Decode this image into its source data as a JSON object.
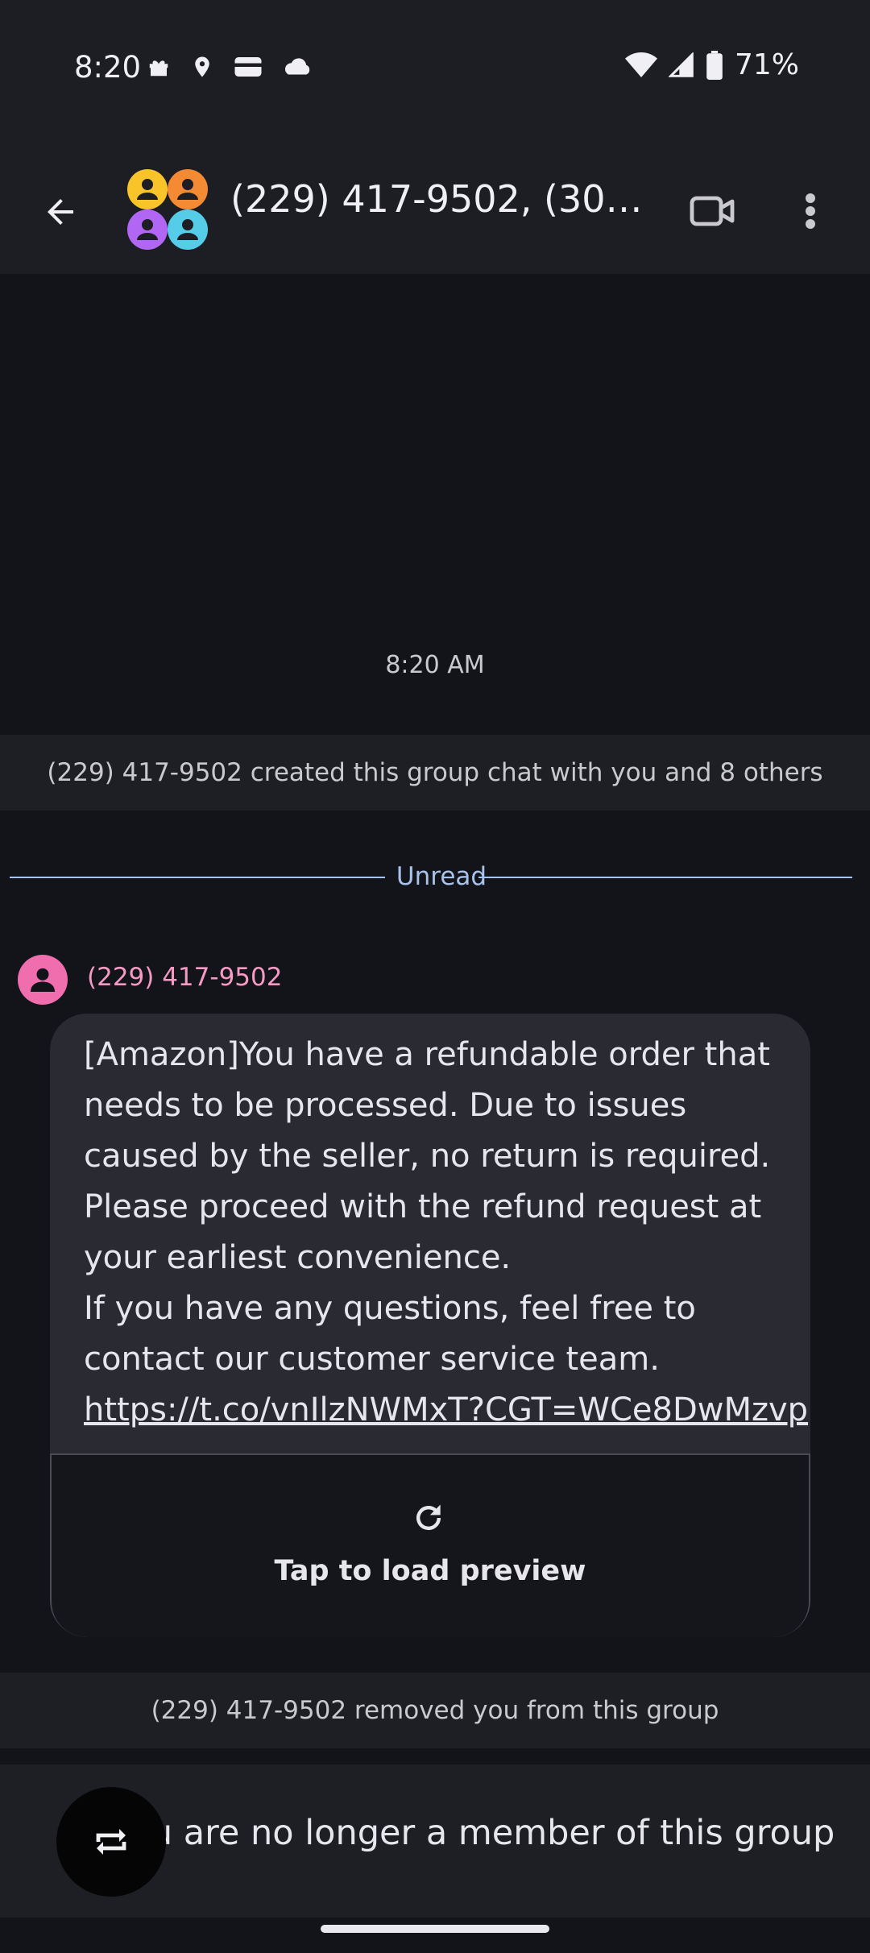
{
  "status_bar": {
    "time": "8:20",
    "battery": "71%",
    "icons": [
      "gift-icon",
      "location-icon",
      "wallet-icon",
      "cloud-icon",
      "wifi-icon",
      "signal-icon",
      "battery-icon"
    ]
  },
  "header": {
    "title": "(229) 417-9502, (302) 2...",
    "avatar_colors": [
      "#f8c42a",
      "#f48a34",
      "#b266f4",
      "#55cce8"
    ]
  },
  "conversation": {
    "timestamp": "8:20 AM",
    "created_notice": "(229) 417-9502 created this group chat with you and 8 others",
    "unread_label": "Unread",
    "message": {
      "sender": "(229) 417-9502",
      "lines": [
        "[Amazon]You have a refundable order that",
        "needs to be processed. Due to issues",
        "caused by the seller, no return is required.",
        "Please proceed with the refund request at",
        "your earliest convenience.",
        "If you have any questions, feel free to",
        "contact our customer service team."
      ],
      "link": "https://t.co/vnIlzNWMxT?CGT=WCe8DwMzvp",
      "preview_label": "Tap to load preview"
    },
    "removed_notice": "(229) 417-9502 removed you from this group"
  },
  "footer": {
    "notice": "You are no longer a member of this group"
  },
  "colors": {
    "background": "#13141a",
    "bar": "#1d1e24",
    "bubble": "#2a2b32",
    "accent_unread": "#a9c2ea",
    "sender": "#f49ac5"
  }
}
